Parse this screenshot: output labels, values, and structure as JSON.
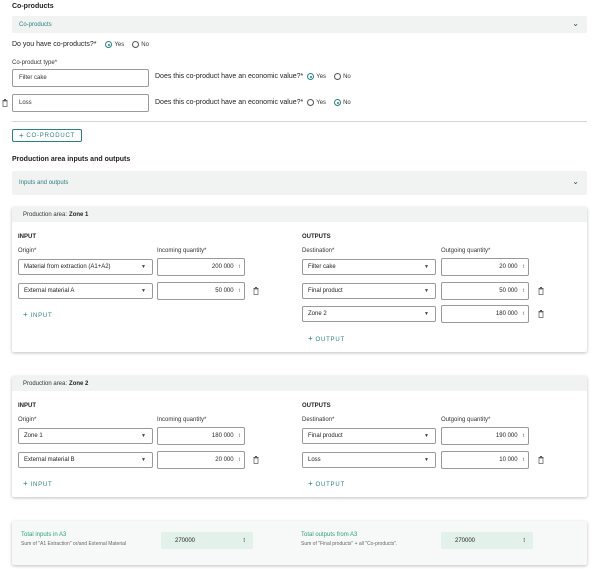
{
  "coproducts": {
    "section_title": "Co-products",
    "accordion_label": "Co-products",
    "question": "Do you have co-products?*",
    "yes": "Yes",
    "no": "No",
    "type_label": "Co-product type*",
    "economic_question": "Does this co-product have an economic value?*",
    "items": [
      {
        "name": "Filter cake",
        "economic_value": "Yes"
      },
      {
        "name": "Loss",
        "economic_value": "No"
      }
    ],
    "add_button": "CO-PRODUCT"
  },
  "production": {
    "section_title": "Production area inputs and outputs",
    "accordion_label": "Inputs and outputs",
    "area_label": "Production area:",
    "input_title": "INPUT",
    "output_title": "OUTPUTS",
    "origin_label": "Origin*",
    "incoming_label": "Incoming quantity*",
    "destination_label": "Destination*",
    "outgoing_label": "Outgoing quantity*",
    "add_input": "INPUT",
    "add_output": "OUTPUT",
    "unit": "t",
    "zones": [
      {
        "name": "Zone 1",
        "inputs": [
          {
            "origin": "Material from extraction (A1+A2)",
            "qty": "200 000"
          },
          {
            "origin": "External material A",
            "qty": "50 000"
          }
        ],
        "outputs": [
          {
            "destination": "Filter cake",
            "qty": "20 000"
          },
          {
            "destination": "Final product",
            "qty": "50 000"
          },
          {
            "destination": "Zone 2",
            "qty": "180 000"
          }
        ]
      },
      {
        "name": "Zone 2",
        "inputs": [
          {
            "origin": "Zone 1",
            "qty": "180 000"
          },
          {
            "origin": "External material B",
            "qty": "20 000"
          }
        ],
        "outputs": [
          {
            "destination": "Final product",
            "qty": "190 000"
          },
          {
            "destination": "Loss",
            "qty": "10 000"
          }
        ]
      }
    ]
  },
  "totals": {
    "inputs_title": "Total inputs in A3",
    "inputs_sub": "Sum of \"A1 Extraction\" or/and External Material",
    "inputs_value": "270000",
    "outputs_title": "Total outputs from A3",
    "outputs_sub": "Sum of \"Final products\" + all \"Co-products\".",
    "outputs_value": "270000",
    "unit": "t"
  },
  "colors": {
    "accent": "#2a7f7f",
    "total_accent": "#2aa37a",
    "total_box": "#e2f1ea"
  },
  "icons": {
    "chevron": "chevron-down-icon",
    "trash": "trash-icon",
    "plus": "plus-icon"
  }
}
